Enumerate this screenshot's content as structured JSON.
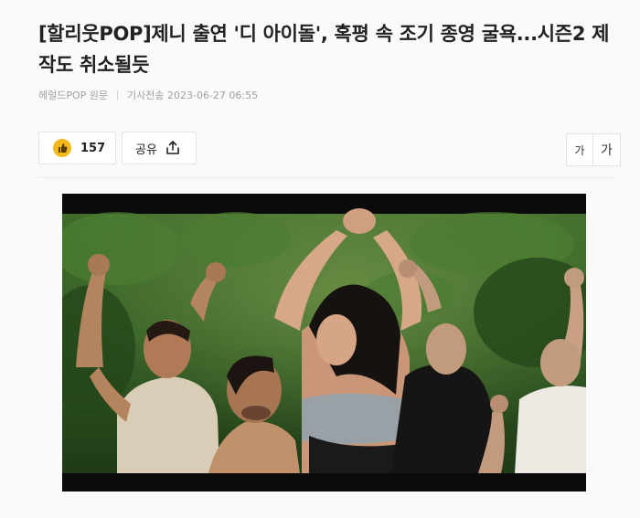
{
  "article": {
    "title": "[할리웃POP]제니 출연 '디 아이돌', 혹평 속 조기 종영 굴욕...시즌2 제작도 취소될듯",
    "source": "헤럴드POP 원문",
    "timestamp": "기사전송 2023-06-27 06:55"
  },
  "actions": {
    "like_count": "157",
    "share_label": "공유",
    "font_small_label": "가",
    "font_large_label": "가"
  },
  "icons": {
    "like": "thumbs-up-icon",
    "share": "share-arrow-icon"
  },
  "colors": {
    "like_badge": "#f2b81c",
    "meta_text": "#a0a0a0",
    "letterbox": "#0b0b0b"
  }
}
